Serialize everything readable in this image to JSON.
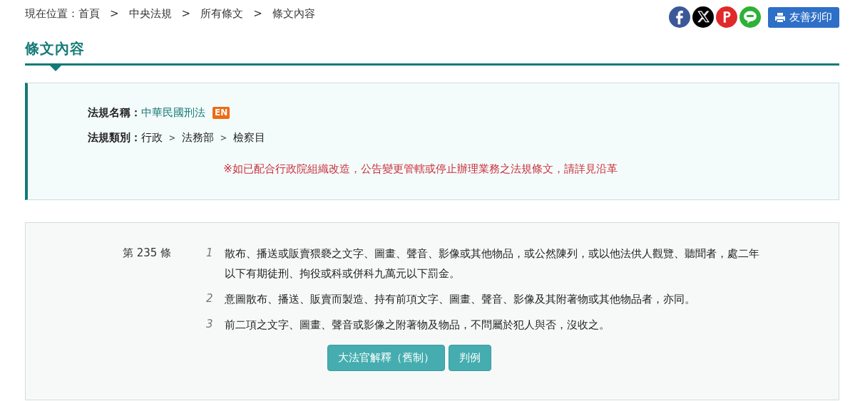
{
  "breadcrumb": {
    "label": "現在位置：",
    "separator": ">",
    "items": [
      "首頁",
      "中央法規",
      "所有條文",
      "條文內容"
    ]
  },
  "share": [
    {
      "kind": "facebook",
      "color": "#3b5998"
    },
    {
      "kind": "x",
      "color": "#000000"
    },
    {
      "kind": "pinterest",
      "color": "#e02a2a"
    },
    {
      "kind": "line",
      "color": "#2db136"
    }
  ],
  "print_button": "友善列印",
  "page_title": "條文內容",
  "law_info": {
    "name_label": "法規名稱：",
    "name": "中華民國刑法",
    "lang_badge": "EN",
    "category_label": "法規類別：",
    "category_separator": "＞",
    "category": [
      "行政",
      "法務部",
      "檢察目"
    ],
    "notice": "※如已配合行政院組織改造，公告變更管轄或停止辦理業務之法規條文，請詳見沿革"
  },
  "article": {
    "number": "第 235 條",
    "paragraphs": [
      {
        "index": "1",
        "text": "散布、播送或販賣猥褻之文字、圖畫、聲音、影像或其他物品，或公然陳列，或以他法供人觀覽、聽聞者，處二年以下有期徒刑、拘役或科或併科九萬元以下罰金。"
      },
      {
        "index": "2",
        "text": "意圖散布、播送、販賣而製造、持有前項文字、圖畫、聲音、影像及其附著物或其他物品者，亦同。"
      },
      {
        "index": "3",
        "text": "前二項之文字、圖畫、聲音或影像之附著物及物品，不問屬於犯人與否，沒收之。"
      }
    ],
    "buttons": [
      "大法官解釋（舊制）",
      "判例"
    ]
  }
}
